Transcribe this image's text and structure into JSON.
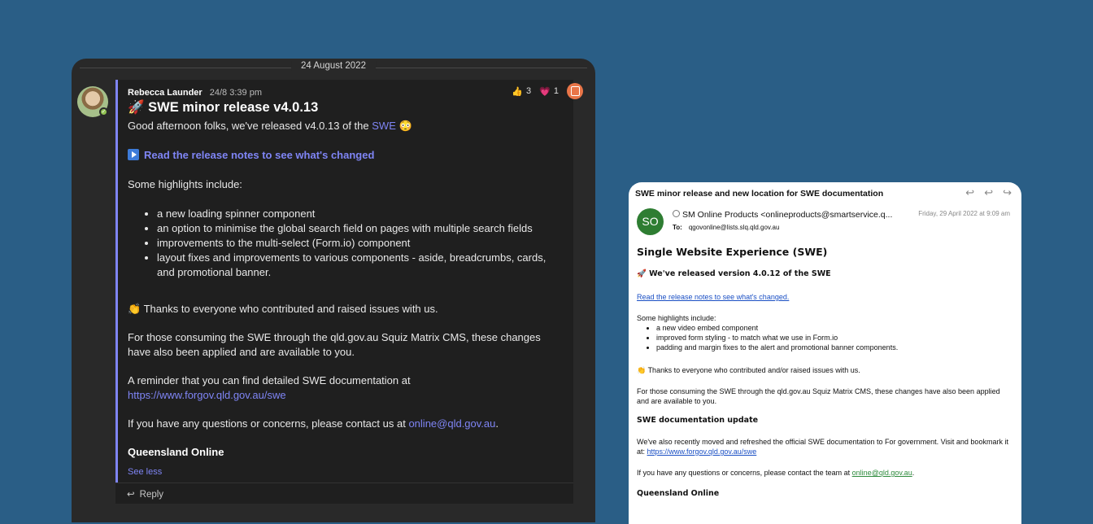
{
  "teams": {
    "date_separator": "24 August 2022",
    "message": {
      "author": "Rebecca Launder",
      "time": "24/8 3:39 pm",
      "title_emoji": "🚀",
      "title": "SWE minor release v4.0.13",
      "intro": "Good afternoon folks, we've released v4.0.13 of the",
      "intro_link": "SWE",
      "intro_emoji": "😳",
      "release_notes_link": "Read the release notes to see what's changed",
      "highlights_intro": "Some highlights include:",
      "highlights": [
        "a new loading spinner component",
        "an option to minimise the global search field on pages with multiple search fields",
        "improvements to the multi-select (Form.io) component",
        "layout fixes and improvements to various components - aside, breadcrumbs, cards, and promotional banner."
      ],
      "thanks_emoji": "👏",
      "thanks": "Thanks to everyone who contributed and raised issues with us.",
      "cms_note": "For those consuming the SWE through the qld.gov.au Squiz Matrix CMS, these changes have also been applied and are available to you.",
      "docs_note": "A reminder that you can find detailed SWE documentation at",
      "docs_link": "https://www.forgov.qld.gov.au/swe",
      "contact_text": "If you have any questions or concerns, please contact us at",
      "contact_link": "online@qld.gov.au",
      "contact_end": ".",
      "signature": "Queensland Online",
      "see_less": "See less"
    },
    "reactions": [
      {
        "icon": "thumbs-up-icon",
        "glyph": "👍",
        "count": "3"
      },
      {
        "icon": "heart-icon",
        "glyph": "💗",
        "count": "1"
      }
    ],
    "reply_label": "Reply"
  },
  "mail": {
    "subject": "SWE minor release and new location for SWE documentation",
    "avatar_initials": "SO",
    "from": "SM Online Products <onlineproducts@smartservice.q...",
    "to_label": "To:",
    "to": "qgovonline@lists.slq.qld.gov.au",
    "date": "Friday, 29 April 2022 at 9:09 am",
    "heading": "Single Website Experience (SWE)",
    "release_emoji": "🚀",
    "release_heading": "We've released version 4.0.12 of the SWE",
    "release_notes_link": "Read the release notes to see what's changed.",
    "highlights_intro": "Some highlights include:",
    "highlights": [
      "a new video embed component",
      "improved form styling - to match what we use in Form.io",
      "padding and margin fixes to the alert and promotional banner components."
    ],
    "thanks_emoji": "👏",
    "thanks": "Thanks to everyone who contributed and/or raised issues with us.",
    "cms_note": "For those consuming the SWE through the qld.gov.au Squiz Matrix CMS, these changes have also been applied and are available to you.",
    "docs_heading": "SWE documentation update",
    "docs_text": "We've also recently moved and refreshed the official SWE documentation to For government. Visit and bookmark it at:",
    "docs_link": "https://www.forgov.qld.gov.au/swe",
    "contact_text": "If you have any questions or concerns, please contact the team at",
    "contact_link": "online@qld.gov.au",
    "contact_end": ".",
    "signature": "Queensland Online"
  }
}
